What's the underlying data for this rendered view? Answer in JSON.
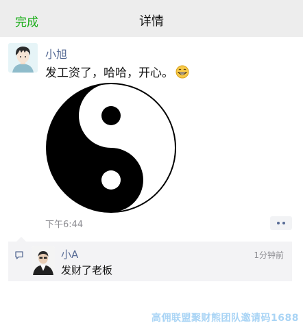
{
  "navbar": {
    "done_label": "完成",
    "title": "详情"
  },
  "post": {
    "author": "小旭",
    "text": "发工资了，哈哈，开心。",
    "emoji": "grinning-face-icon",
    "image": "yin-yang-image",
    "time": "下午6:44",
    "more": "more-dots-icon"
  },
  "comment": {
    "icon": "comment-icon",
    "author": "小A",
    "time": "1分钟前",
    "text": "发财了老板"
  },
  "watermark": "高佣联盟聚财熊团队邀请码1688",
  "colors": {
    "accent_green": "#1aad19",
    "link_blue": "#576b95",
    "navbar_bg": "#ededed",
    "comment_bg": "#f3f3f5",
    "meta_gray": "#8e8e93"
  }
}
